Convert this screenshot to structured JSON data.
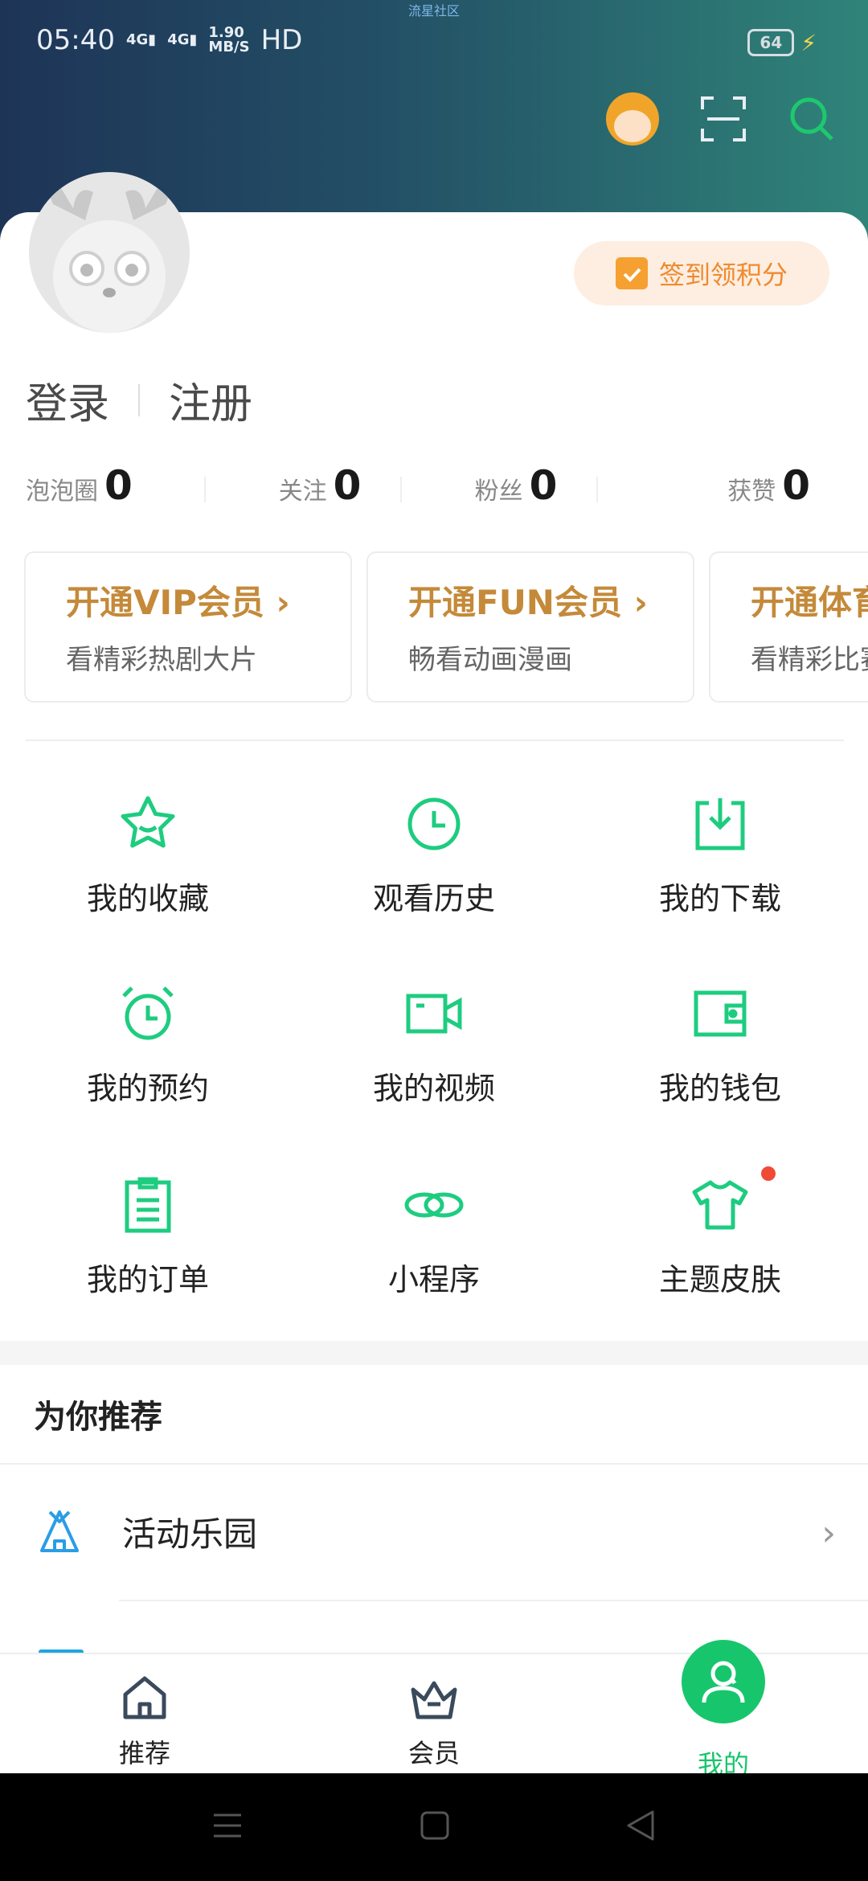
{
  "status_bar": {
    "watermark": "流星社区",
    "time": "05:40",
    "net1": "4G",
    "net2": "4G",
    "speed": "1.90",
    "speed_unit": "MB/S",
    "hd": "HD",
    "battery": "64"
  },
  "sign_in_button": "签到领积分",
  "auth": {
    "login": "登录",
    "register": "注册"
  },
  "stats": [
    {
      "label": "泡泡圈",
      "value": "0"
    },
    {
      "label": "关注",
      "value": "0"
    },
    {
      "label": "粉丝",
      "value": "0"
    },
    {
      "label": "获赞",
      "value": "0"
    }
  ],
  "cards": [
    {
      "title": "开通VIP会员 ›",
      "sub": "看精彩热剧大片"
    },
    {
      "title": "开通FUN会员 ›",
      "sub": "畅看动画漫画"
    },
    {
      "title": "开通体育",
      "sub": "看精彩比赛"
    }
  ],
  "grid": [
    {
      "label": "我的收藏",
      "icon": "star-icon"
    },
    {
      "label": "观看历史",
      "icon": "clock-icon"
    },
    {
      "label": "我的下载",
      "icon": "download-icon"
    },
    {
      "label": "我的预约",
      "icon": "alarm-clock-icon"
    },
    {
      "label": "我的视频",
      "icon": "video-camera-icon"
    },
    {
      "label": "我的钱包",
      "icon": "wallet-icon"
    },
    {
      "label": "我的订单",
      "icon": "clipboard-icon"
    },
    {
      "label": "小程序",
      "icon": "link-icon"
    },
    {
      "label": "主题皮肤",
      "icon": "tshirt-icon"
    }
  ],
  "recommend": {
    "title": "为你推荐",
    "items": [
      {
        "label": "活动乐园",
        "icon": "tent-icon"
      }
    ]
  },
  "tabs": [
    {
      "label": "推荐"
    },
    {
      "label": "会员"
    },
    {
      "label": "我的"
    }
  ],
  "colors": {
    "accent": "#17c66c",
    "gold": "#c48a3a",
    "badge": "#f04a37",
    "signin": "#f08a2e"
  }
}
